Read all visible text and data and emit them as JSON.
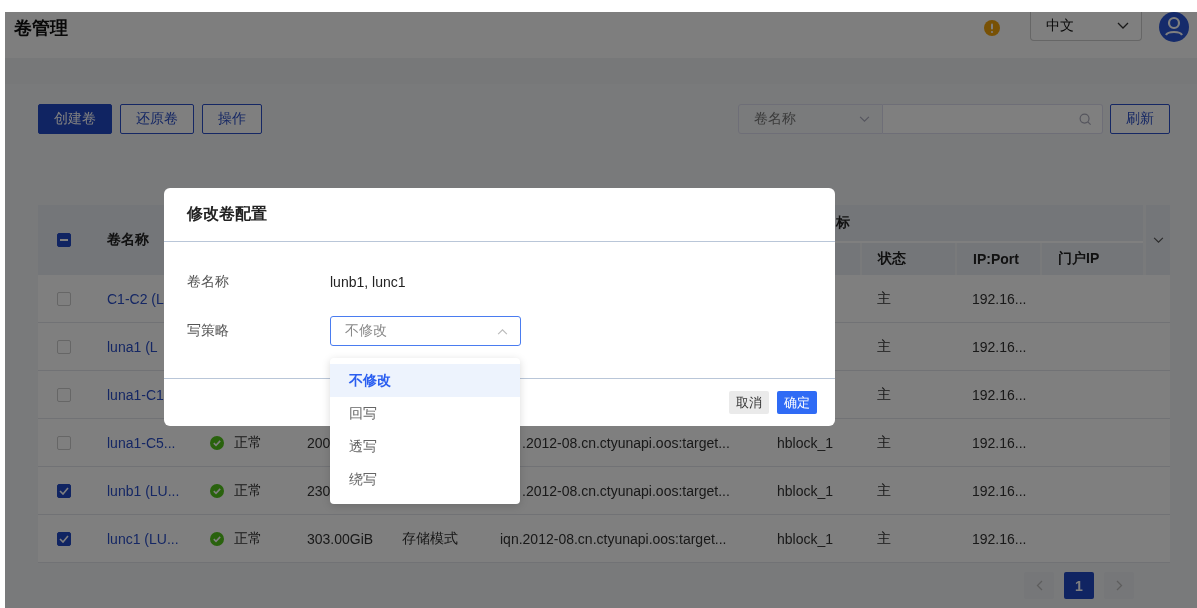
{
  "header": {
    "title": "卷管理",
    "language": "中文"
  },
  "toolbar": {
    "buttons": [
      {
        "label": "创建卷",
        "kind": "primary"
      },
      {
        "label": "还原卷",
        "kind": "outline"
      },
      {
        "label": "操作",
        "kind": "outline"
      }
    ],
    "search_filter": "卷名称",
    "refresh": "刷新"
  },
  "table": {
    "select_all": {
      "indeterminate": true
    },
    "name_column": "卷名称",
    "group_header": "标",
    "sub_columns": [
      "状态",
      "IP:Port",
      "门户IP"
    ],
    "rows": [
      {
        "checked": false,
        "name": "C1-C2 (L",
        "role": "主",
        "ip": "192.16..."
      },
      {
        "checked": false,
        "name": "luna1 (L",
        "role": "主",
        "ip": "192.16..."
      },
      {
        "checked": false,
        "name": "luna1-C1",
        "role": "主",
        "ip": "192.16..."
      },
      {
        "checked": false,
        "name": "luna1-C5...",
        "healthy": true,
        "status": "正常",
        "capacity": "200",
        "iqn": ".2012-08.cn.ctyunapi.oos:target...",
        "host": "hblock_1",
        "role": "主",
        "ip": "192.16..."
      },
      {
        "checked": true,
        "name": "lunb1 (LU...",
        "healthy": true,
        "status": "正常",
        "capacity": "230",
        "iqn": ".2012-08.cn.ctyunapi.oos:target...",
        "host": "hblock_1",
        "role": "主",
        "ip": "192.16..."
      },
      {
        "checked": true,
        "name": "lunc1 (LU...",
        "healthy": true,
        "status": "正常",
        "capacity": "303.00GiB",
        "mode": "存储模式",
        "iqn": "iqn.2012-08.cn.ctyunapi.oos:target...",
        "host": "hblock_1",
        "role": "主",
        "ip": "192.16..."
      }
    ]
  },
  "pagination": {
    "pages": [
      {
        "label": "1",
        "selected": true
      }
    ]
  },
  "dialog": {
    "title": "修改卷配置",
    "fields": [
      {
        "kind": "text",
        "label": "卷名称",
        "value": "lunb1, lunc1"
      },
      {
        "kind": "select",
        "label": "写策略",
        "value": "不修改",
        "open": true,
        "options": [
          {
            "label": "不修改",
            "selected": true
          },
          {
            "label": "回写",
            "selected": false
          },
          {
            "label": "透写",
            "selected": false
          },
          {
            "label": "绕写",
            "selected": false
          }
        ]
      }
    ],
    "buttons": [
      {
        "label": "取消",
        "kind": "default"
      },
      {
        "label": "确定",
        "kind": "primary"
      }
    ]
  }
}
